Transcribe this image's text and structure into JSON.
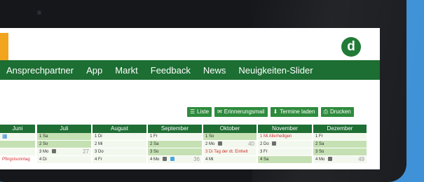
{
  "nav": {
    "items": [
      "Ansprechpartner",
      "App",
      "Markt",
      "Feedback",
      "News",
      "Neuigkeiten-Slider"
    ]
  },
  "logo": {
    "letter": "d"
  },
  "toolbar": {
    "buttons": [
      {
        "label": "Liste",
        "icon": "list-icon"
      },
      {
        "label": "Erinnerungsmail",
        "icon": "envelope-icon"
      },
      {
        "label": "Termine laden",
        "icon": "download-icon"
      },
      {
        "label": "Drucken",
        "icon": "print-icon"
      }
    ]
  },
  "calendar": {
    "months": [
      {
        "name": "Juni",
        "days": [
          "",
          "",
          "",
          "Pfingstsonntag"
        ]
      },
      {
        "name": "Juli",
        "days": [
          "1 Sa",
          "2 So",
          "3 Mo",
          "4 Di"
        ],
        "kw": "27"
      },
      {
        "name": "August",
        "days": [
          "1 Di",
          "2 Mi",
          "3 Do",
          "4 Fr"
        ]
      },
      {
        "name": "September",
        "days": [
          "1 Fr",
          "2 Sa",
          "3 So",
          "4 Mo"
        ],
        "kw": "36"
      },
      {
        "name": "Oktober",
        "days": [
          "1 So",
          "2 Mo",
          "3 Di  Tag der dt. Einheit",
          "4 Mi"
        ],
        "kw": "40"
      },
      {
        "name": "November",
        "days": [
          "1 Mi  Allerheiligen",
          "2 Do",
          "3 Fr",
          "4 Sa"
        ]
      },
      {
        "name": "Dezember",
        "days": [
          "1 Fr",
          "2 Sa",
          "3 So",
          "4 Mo"
        ],
        "kw": "49"
      }
    ]
  },
  "colors": {
    "nav": "#1c6e32",
    "month_header": "#1f6e34",
    "button": "#2e8b3d",
    "weekend": "#c5e0b3",
    "holiday_text": "#d0312d",
    "logo_tab": "#f2a51c",
    "background": "#3a8fd6"
  }
}
